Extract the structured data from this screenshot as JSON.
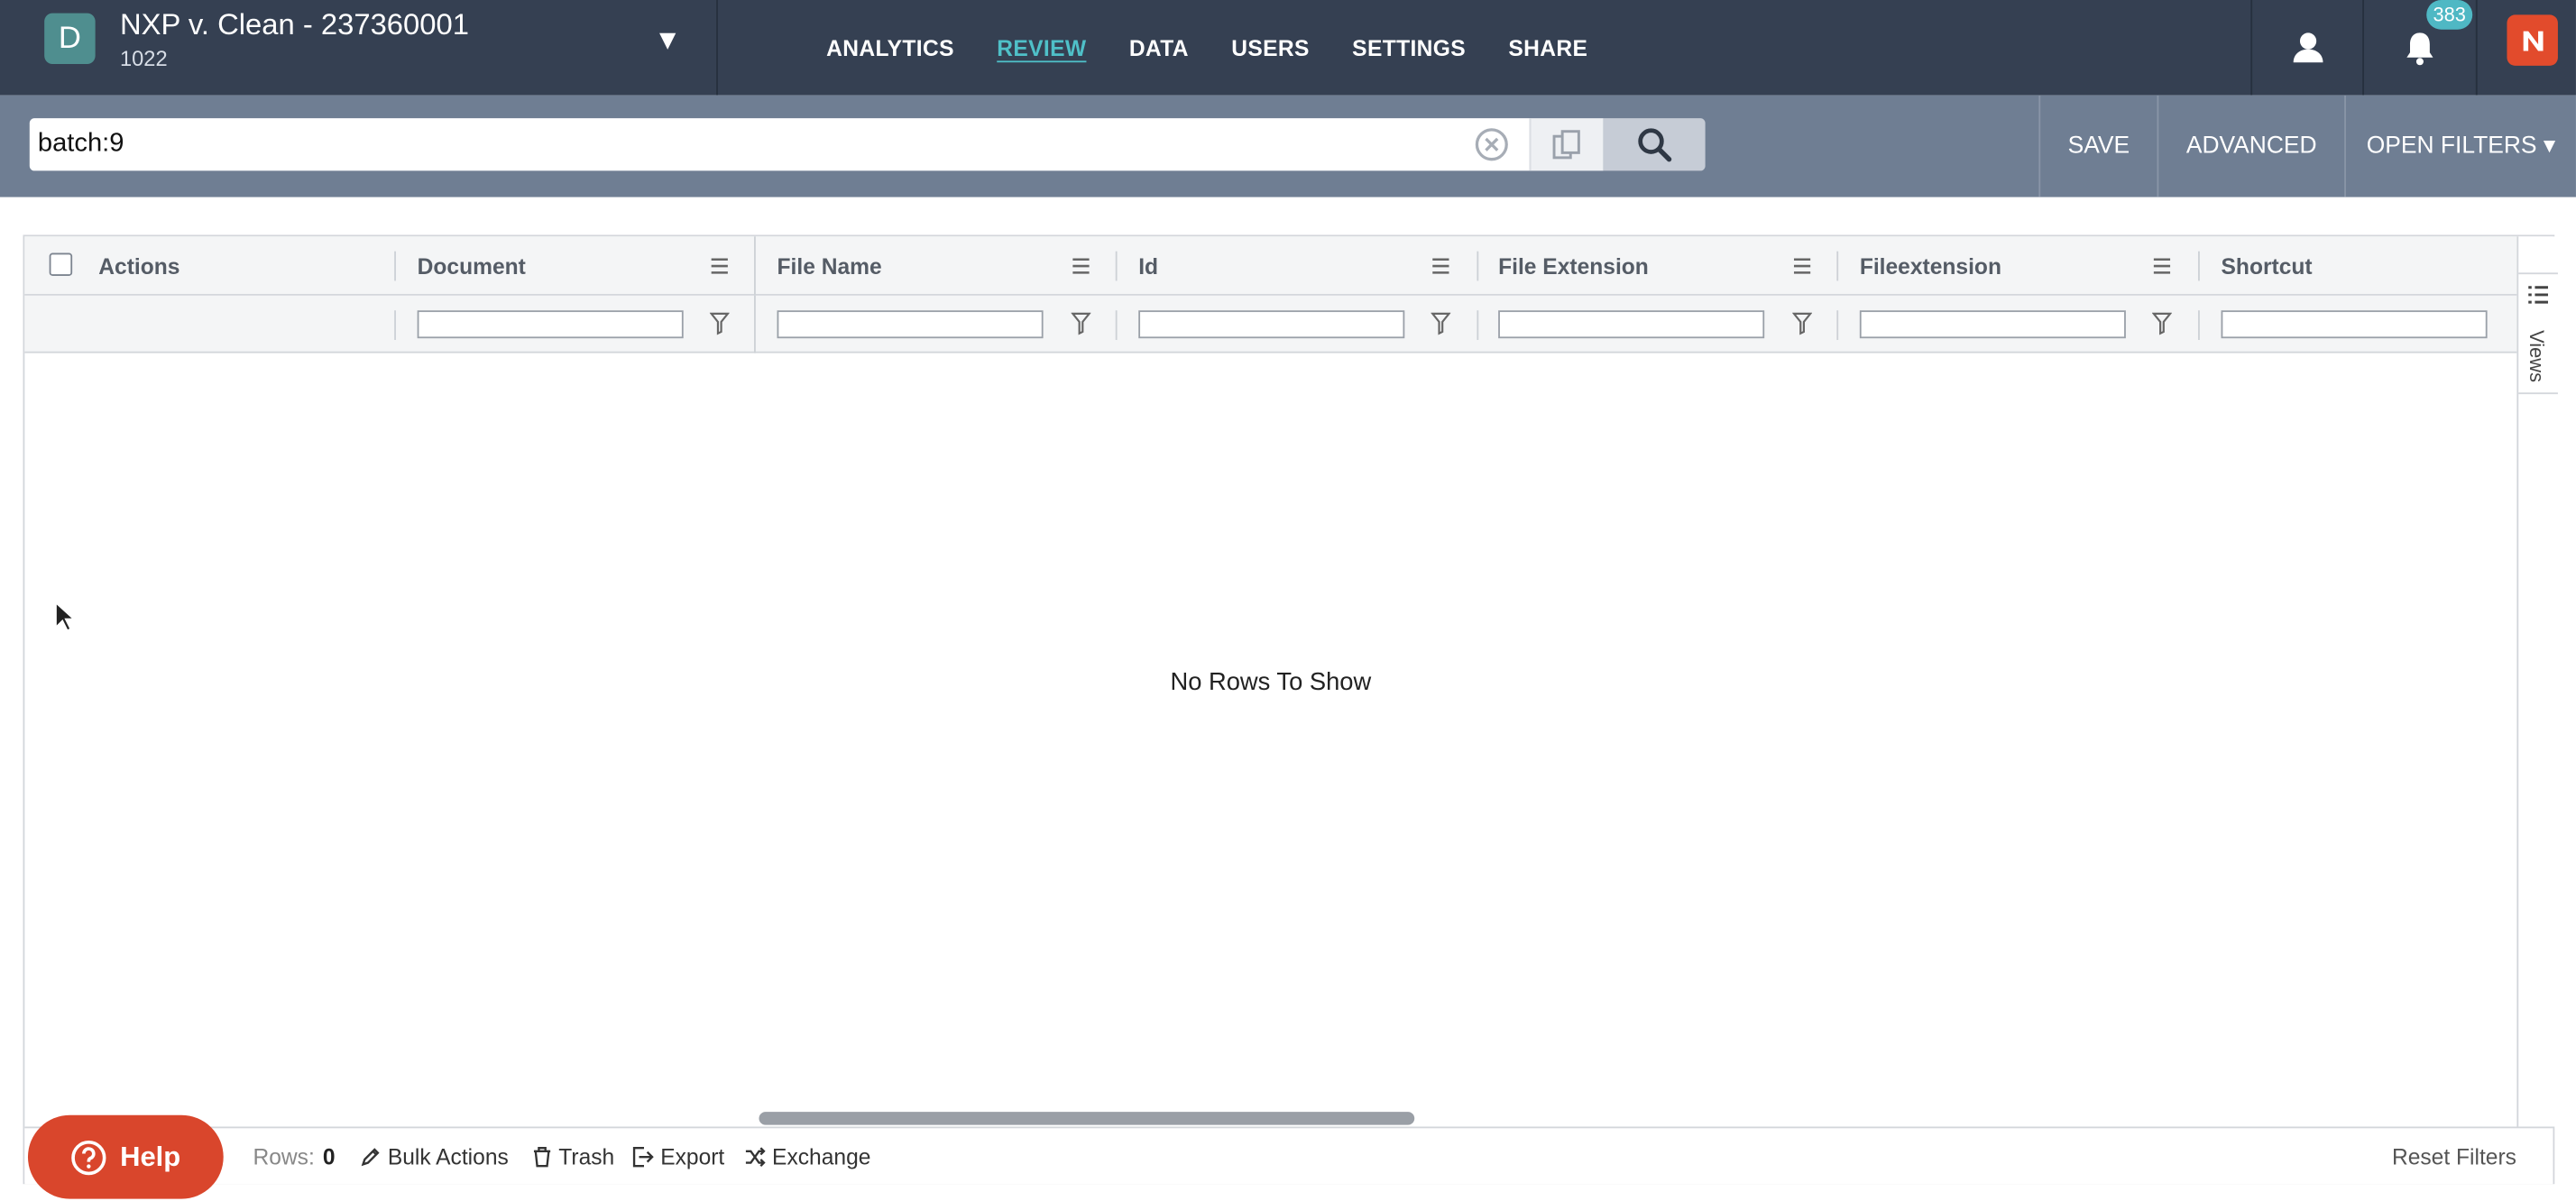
{
  "project": {
    "badge": "D",
    "title": "NXP v. Clean - 237360001",
    "subtitle": "1022",
    "caret": "▼"
  },
  "nav": {
    "items": [
      {
        "label": "ANALYTICS"
      },
      {
        "label": "REVIEW",
        "active": true
      },
      {
        "label": "DATA"
      },
      {
        "label": "USERS"
      },
      {
        "label": "SETTINGS"
      },
      {
        "label": "SHARE"
      }
    ]
  },
  "header_icons": {
    "user": "user-icon",
    "notifications": "bell-icon",
    "notification_count": "383",
    "brand": "brand-logo"
  },
  "search": {
    "value": "batch:9",
    "clear": "clear-icon",
    "copy": "copy-icon",
    "submit": "search-icon"
  },
  "search_actions": {
    "save": "SAVE",
    "advanced": "ADVANCED",
    "open_filters": "OPEN FILTERS ▾"
  },
  "grid": {
    "columns": [
      {
        "label": "Actions"
      },
      {
        "label": "Document"
      },
      {
        "label": "File Name"
      },
      {
        "label": "Id"
      },
      {
        "label": "File Extension"
      },
      {
        "label": "Fileextension"
      },
      {
        "label": "Shortcut"
      }
    ],
    "empty_message": "No Rows To Show",
    "side_panel": "Views"
  },
  "footer": {
    "rows_label": "Rows:",
    "rows_count": "0",
    "bulk_actions": "Bulk Actions",
    "trash": "Trash",
    "export": "Export",
    "exchange": "Exchange",
    "reset_filters": "Reset Filters"
  },
  "help": {
    "label": "Help"
  },
  "colors": {
    "topbar": "#354052",
    "searchbar": "#6f7e93",
    "accent": "#4fc0c8",
    "help": "#d9462c",
    "brand": "#e24b2c"
  }
}
